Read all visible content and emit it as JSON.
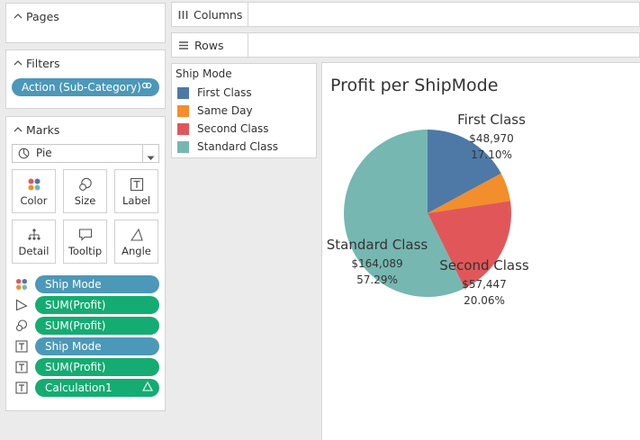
{
  "pages": {
    "title": "Pages"
  },
  "filters": {
    "title": "Filters",
    "pill": "Action (Sub-Category)"
  },
  "marks": {
    "title": "Marks",
    "mark_type": "Pie",
    "buttons": {
      "color": "Color",
      "size": "Size",
      "label": "Label",
      "detail": "Detail",
      "tooltip": "Tooltip",
      "angle": "Angle"
    },
    "fields": [
      {
        "icon": "color-icon",
        "label": "Ship Mode",
        "kind": "dimension"
      },
      {
        "icon": "angle-icon",
        "label": "SUM(Profit)",
        "kind": "measure"
      },
      {
        "icon": "size-icon",
        "label": "SUM(Profit)",
        "kind": "measure"
      },
      {
        "icon": "label-icon",
        "label": "Ship Mode",
        "kind": "dimension"
      },
      {
        "icon": "label-icon",
        "label": "SUM(Profit)",
        "kind": "measure"
      },
      {
        "icon": "label-icon",
        "label": "Calculation1",
        "kind": "measure"
      }
    ]
  },
  "columns_shelf": {
    "label": "Columns"
  },
  "rows_shelf": {
    "label": "Rows"
  },
  "legend": {
    "title": "Ship Mode",
    "items": [
      {
        "label": "First Class",
        "color": "#4e79a7"
      },
      {
        "label": "Same Day",
        "color": "#f28e2b"
      },
      {
        "label": "Second Class",
        "color": "#e15759"
      },
      {
        "label": "Standard Class",
        "color": "#76b7b2"
      }
    ]
  },
  "chart_data": {
    "type": "pie",
    "title": "Profit per ShipMode",
    "slices": [
      {
        "label": "First Class",
        "value": 48970,
        "value_text": "$48,970",
        "percent_text": "17.10%",
        "color": "#4e79a7",
        "labeled": true
      },
      {
        "label": "Same Day",
        "value": 15892,
        "value_text": "",
        "percent_text": "",
        "color": "#f28e2b",
        "labeled": false
      },
      {
        "label": "Second Class",
        "value": 57447,
        "value_text": "$57,447",
        "percent_text": "20.06%",
        "color": "#e15759",
        "labeled": true
      },
      {
        "label": "Standard Class",
        "value": 164089,
        "value_text": "$164,089",
        "percent_text": "57.29%",
        "color": "#76b7b2",
        "labeled": true
      }
    ]
  }
}
